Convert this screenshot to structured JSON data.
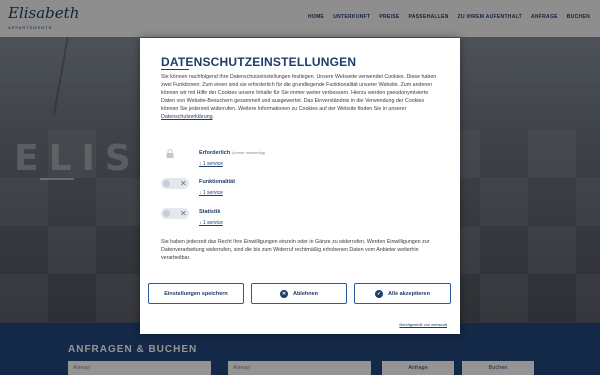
{
  "site": {
    "logo_script": "Elisabeth",
    "logo_sub": "APPARTEMENTS",
    "nav": [
      "HOME",
      "UNTERKUNFT",
      "PREISE",
      "PASSEHALLEN",
      "ZU IHREM AUFENTHALT",
      "ANFRAGE",
      "BUCHEN"
    ],
    "hero_title": "ELISABE",
    "booking": {
      "title": "ANFRAGEN & BUCHEN",
      "arrival_placeholder": "Anreise",
      "departure_placeholder": "Anreise",
      "inquiry_button": "Anfrage",
      "book_button": "Buchen"
    }
  },
  "cookie_modal": {
    "title": "DATENSCHUTZEINSTELLUNGEN",
    "intro": "Sie können nachfolgend Ihre Datenschutzeinstellungen festlegen. Unsere Webseite verwendet Cookies. Diese haben zwei Funktionen: Zum einen sind sie erforderlich für die grundlegende Funktionalität unserer Website. Zum anderen können wir mit Hilfe der Cookies unsere Inhalte für Sie immer weiter verbessern. Hierzu werden pseudonymisierte Daten von Website-Besuchern gesammelt und ausgewertet. Das Einverständnis in die Verwendung der Cookies können Sie jederzeit widerrufen. Weitere Informationen zu Cookies auf der Website finden Sie in unserer",
    "privacy_link": "Datenschutzerklärung",
    "categories": [
      {
        "name": "Erforderlich",
        "note": "(immer notwendig)",
        "services": "↓ 1 service",
        "control": "lock-icon"
      },
      {
        "name": "Funktionalität",
        "note": "",
        "services": "↓ 1 service",
        "control": "toggle-off"
      },
      {
        "name": "Statistik",
        "note": "",
        "services": "↓ 1 service",
        "control": "toggle-off"
      }
    ],
    "rights_text": "Sie haben jederzeit das Recht Ihre Einwilligungen einzeln oder in Gänze zu widerrufen. Werden Einwilligungen zur Datenverarbeitung widerrufen, sind die bis zum Widerruf rechtmäßig erhobenen Daten vom Anbieter weiterhin verarbeitbar.",
    "buttons": {
      "save": "Einstellungen speichern",
      "reject": "Ablehnen",
      "accept_all": "Alle akzeptieren"
    },
    "toggle_off_symbol": "✕",
    "reject_symbol": "✕",
    "accept_symbol": "✓",
    "powered_by": "Bereitgestellt von websedit"
  },
  "colors": {
    "primary": "#1f3d6b",
    "booking_bar": "#23457c",
    "toggle_bg": "#e3e8ef"
  }
}
